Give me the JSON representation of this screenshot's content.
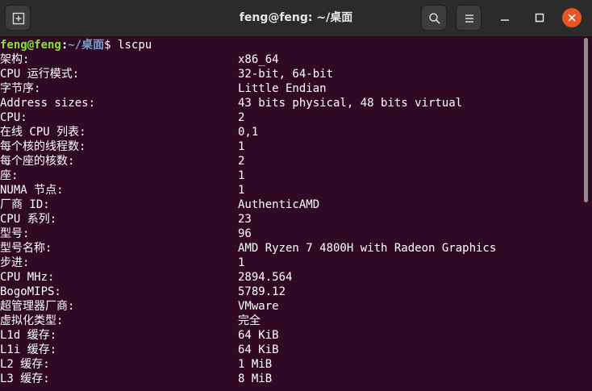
{
  "window": {
    "title": "feng@feng: ~/桌面"
  },
  "prompt": {
    "user": "feng@feng",
    "sep": ":",
    "path": "~/桌面",
    "symbol": "$",
    "command": "lscpu"
  },
  "rows": [
    {
      "k": "架构:",
      "v": "x86_64"
    },
    {
      "k": "CPU 运行模式:",
      "v": "32-bit, 64-bit"
    },
    {
      "k": "字节序:",
      "v": "Little Endian"
    },
    {
      "k": "Address sizes:",
      "v": "43 bits physical, 48 bits virtual"
    },
    {
      "k": "CPU:",
      "v": "2"
    },
    {
      "k": "在线 CPU 列表:",
      "v": "0,1"
    },
    {
      "k": "每个核的线程数:",
      "v": "1"
    },
    {
      "k": "每个座的核数:",
      "v": "2"
    },
    {
      "k": "座:",
      "v": "1"
    },
    {
      "k": "NUMA 节点:",
      "v": "1"
    },
    {
      "k": "厂商 ID:",
      "v": "AuthenticAMD"
    },
    {
      "k": "CPU 系列:",
      "v": "23"
    },
    {
      "k": "型号:",
      "v": "96"
    },
    {
      "k": "型号名称:",
      "v": "AMD Ryzen 7 4800H with Radeon Graphics"
    },
    {
      "k": "步进:",
      "v": "1"
    },
    {
      "k": "CPU MHz:",
      "v": "2894.564"
    },
    {
      "k": "BogoMIPS:",
      "v": "5789.12"
    },
    {
      "k": "超管理器厂商:",
      "v": "VMware"
    },
    {
      "k": "虚拟化类型:",
      "v": "完全"
    },
    {
      "k": "L1d 缓存:",
      "v": "64 KiB"
    },
    {
      "k": "L1i 缓存:",
      "v": "64 KiB"
    },
    {
      "k": "L2 缓存:",
      "v": "1 MiB"
    },
    {
      "k": "L3 缓存:",
      "v": "8 MiB"
    }
  ],
  "colors": {
    "background": "#300a24",
    "titlebar": "#2b2b2b",
    "prompt_user": "#8ae234",
    "prompt_path": "#729fcf",
    "close": "#e95420"
  },
  "icons": {
    "new_tab": "new-tab-icon",
    "search": "search-icon",
    "menu": "hamburger-menu-icon",
    "minimize": "minimize-icon",
    "maximize": "maximize-icon",
    "close": "close-icon"
  }
}
